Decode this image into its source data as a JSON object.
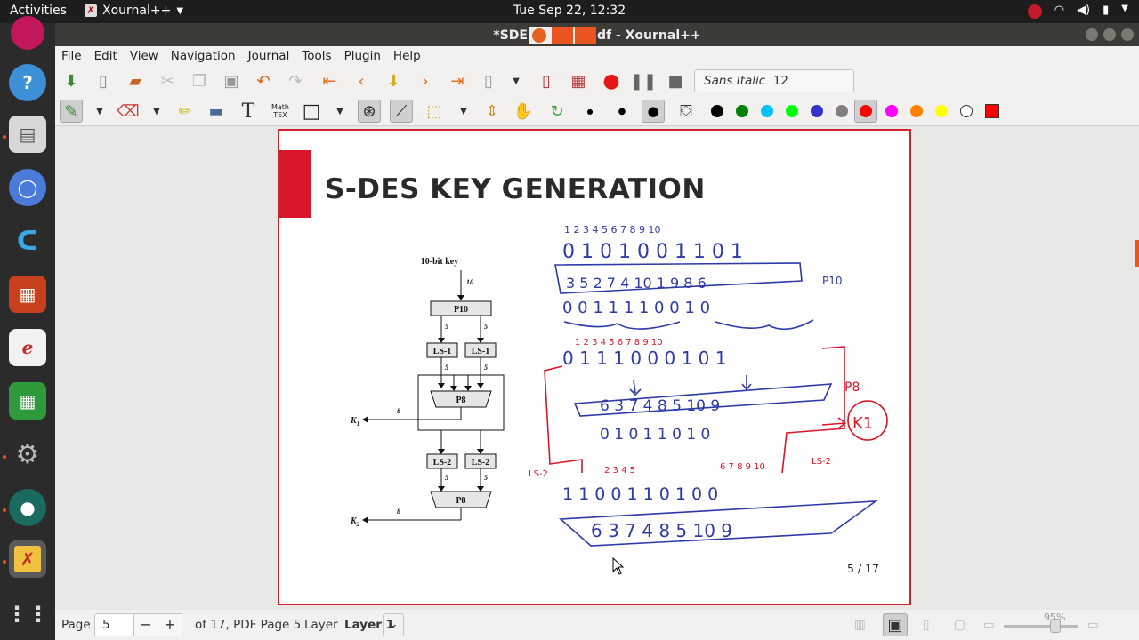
{
  "topbar": {
    "activities": "Activities",
    "app_name": "Xournal++",
    "clock": "Tue Sep 22, 12:32"
  },
  "window": {
    "title_left": "*SDE",
    "title_right": "df - Xournal++"
  },
  "menu": [
    "File",
    "Edit",
    "View",
    "Navigation",
    "Journal",
    "Tools",
    "Plugin",
    "Help"
  ],
  "toolbar": {
    "font_name": "Sans Italic",
    "font_size": "12",
    "mathtex_label": "Math\nTEX",
    "colors": [
      "#000000",
      "#008000",
      "#00c0ff",
      "#00ff00",
      "#3333cc",
      "#808080",
      "#ff0000",
      "#ff00ff",
      "#ff8000",
      "#ffff00",
      "#ffffff"
    ],
    "active_color": "#ff0000"
  },
  "slide": {
    "title": "S-DES KEY GENERATION",
    "page_number": "5 / 17"
  },
  "diagram": {
    "key_label": "10-bit key",
    "p10": "P10",
    "ls1a": "LS-1",
    "ls1b": "LS-1",
    "p8a": "P8",
    "ls2a": "LS-2",
    "ls2b": "LS-2",
    "p8b": "P8",
    "k1": "K",
    "k1sub": "1",
    "k2": "K",
    "k2sub": "2",
    "n10": "10",
    "n5": "5",
    "n8": "8"
  },
  "statusbar": {
    "page_label": "Page",
    "page_value": "5",
    "minus": "−",
    "plus": "+",
    "of_pages": "of 17, PDF Page 5",
    "layer_label": "Layer",
    "layer_value": "Layer 1",
    "zoom": "95%"
  }
}
